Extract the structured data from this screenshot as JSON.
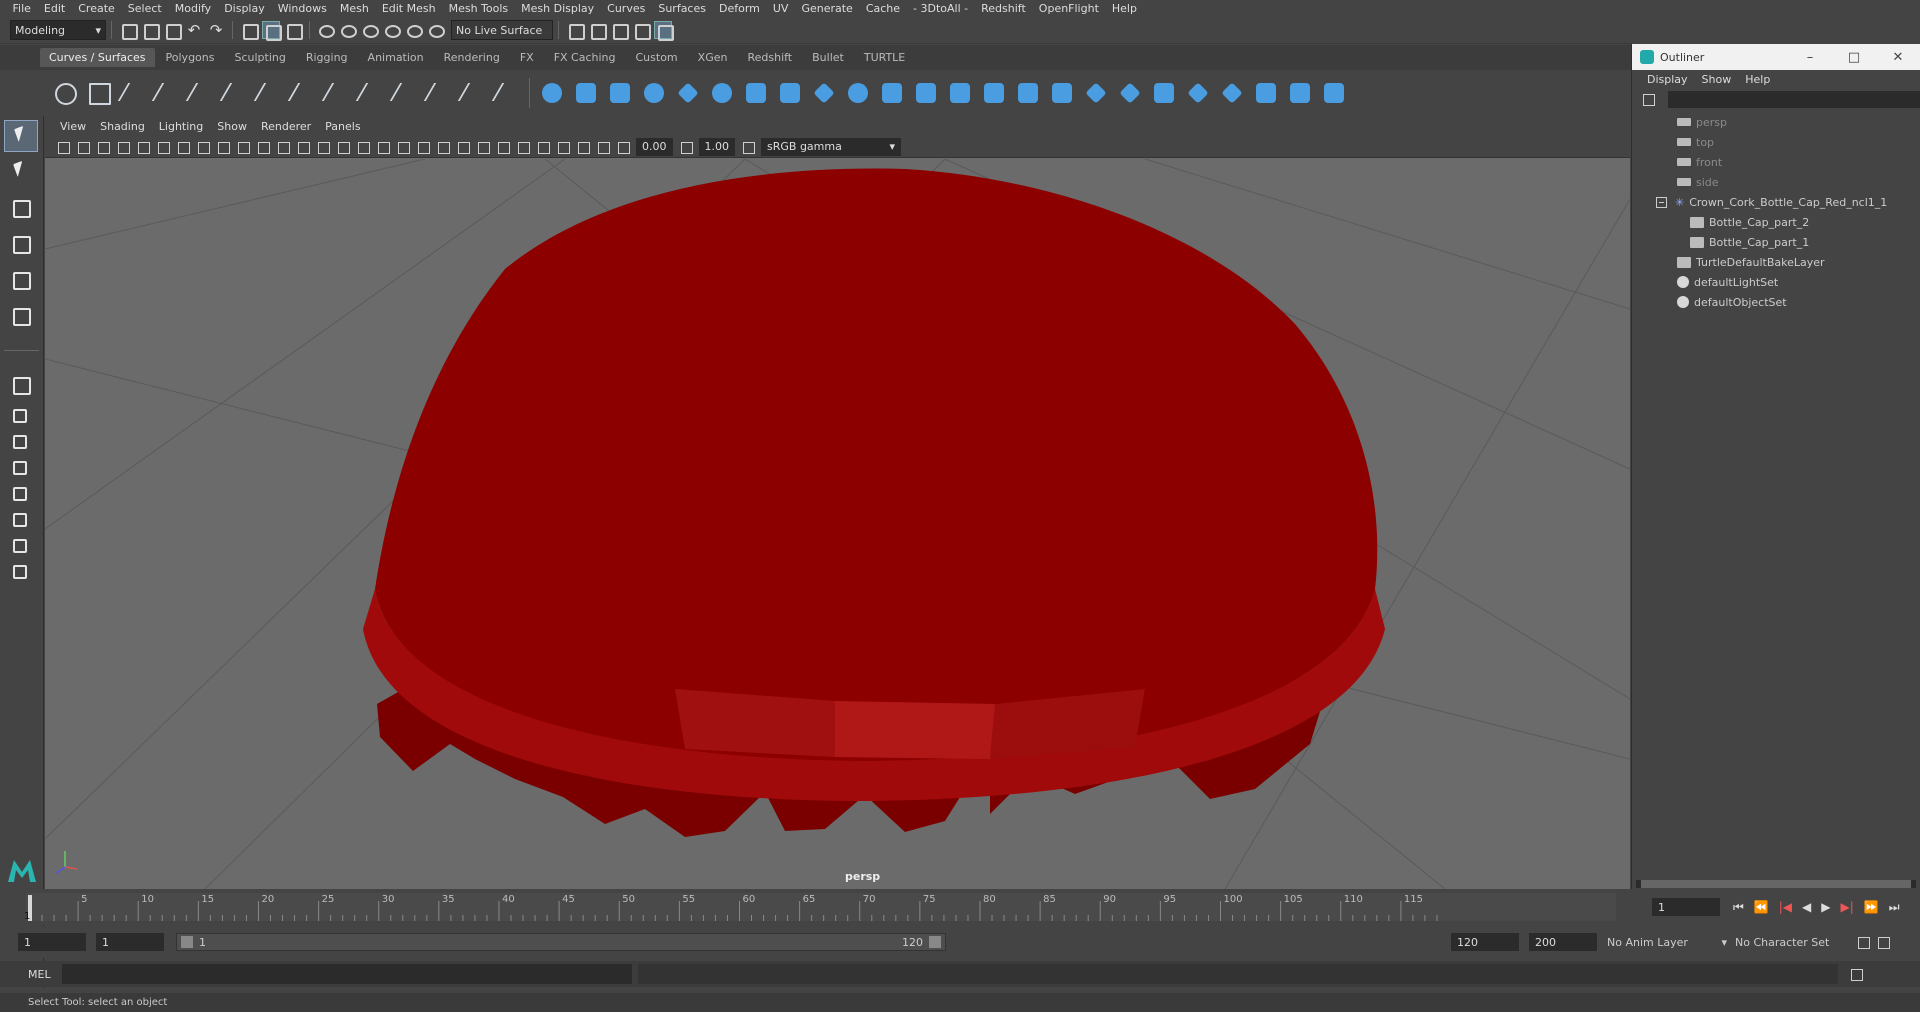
{
  "menubar": [
    "File",
    "Edit",
    "Create",
    "Select",
    "Modify",
    "Display",
    "Windows",
    "Mesh",
    "Edit Mesh",
    "Mesh Tools",
    "Mesh Display",
    "Curves",
    "Surfaces",
    "Deform",
    "UV",
    "Generate",
    "Cache",
    "- 3DtoAll -",
    "Redshift",
    "OpenFlight",
    "Help"
  ],
  "toolbar": {
    "mode": "Modeling",
    "live_surface": "No Live Surface"
  },
  "shelf_tabs": [
    "Curves / Surfaces",
    "Polygons",
    "Sculpting",
    "Rigging",
    "Animation",
    "Rendering",
    "FX",
    "FX Caching",
    "Custom",
    "XGen",
    "Redshift",
    "Bullet",
    "TURTLE"
  ],
  "active_shelf_tab": "Curves / Surfaces",
  "viewport": {
    "menu": [
      "View",
      "Shading",
      "Lighting",
      "Show",
      "Renderer",
      "Panels"
    ],
    "exposure": "0.00",
    "gamma": "1.00",
    "color_space": "sRGB gamma",
    "camera_label": "persp"
  },
  "outliner": {
    "title": "Outliner",
    "menu": [
      "Display",
      "Show",
      "Help"
    ],
    "items": [
      {
        "label": "persp",
        "type": "camera"
      },
      {
        "label": "top",
        "type": "camera"
      },
      {
        "label": "front",
        "type": "camera"
      },
      {
        "label": "side",
        "type": "camera"
      },
      {
        "label": "Crown_Cork_Bottle_Cap_Red_ncl1_1",
        "type": "group"
      },
      {
        "label": "Bottle_Cap_part_2",
        "type": "mesh"
      },
      {
        "label": "Bottle_Cap_part_1",
        "type": "mesh"
      },
      {
        "label": "TurtleDefaultBakeLayer",
        "type": "layer"
      },
      {
        "label": "defaultLightSet",
        "type": "set"
      },
      {
        "label": "defaultObjectSet",
        "type": "set"
      }
    ]
  },
  "timeline": {
    "ticks": [
      "5",
      "10",
      "15",
      "20",
      "25",
      "30",
      "35",
      "40",
      "45",
      "50",
      "55",
      "60",
      "65",
      "70",
      "75",
      "80",
      "85",
      "90",
      "95",
      "100",
      "105",
      "110",
      "115"
    ],
    "start_marker": "1",
    "current_frame": "1"
  },
  "range": {
    "start": "1",
    "playback_start": "1",
    "slider_start": "1",
    "slider_end": "120",
    "playback_end": "120",
    "end": "200",
    "anim_layer": "No Anim Layer",
    "character_set": "No Character Set"
  },
  "command_line": {
    "label": "MEL"
  },
  "status_line": "Select Tool: select an object",
  "colors": {
    "cap_red": "#8b0000",
    "viewport_bg": "#6b6b6b",
    "accent_blue": "#4a9de0"
  }
}
